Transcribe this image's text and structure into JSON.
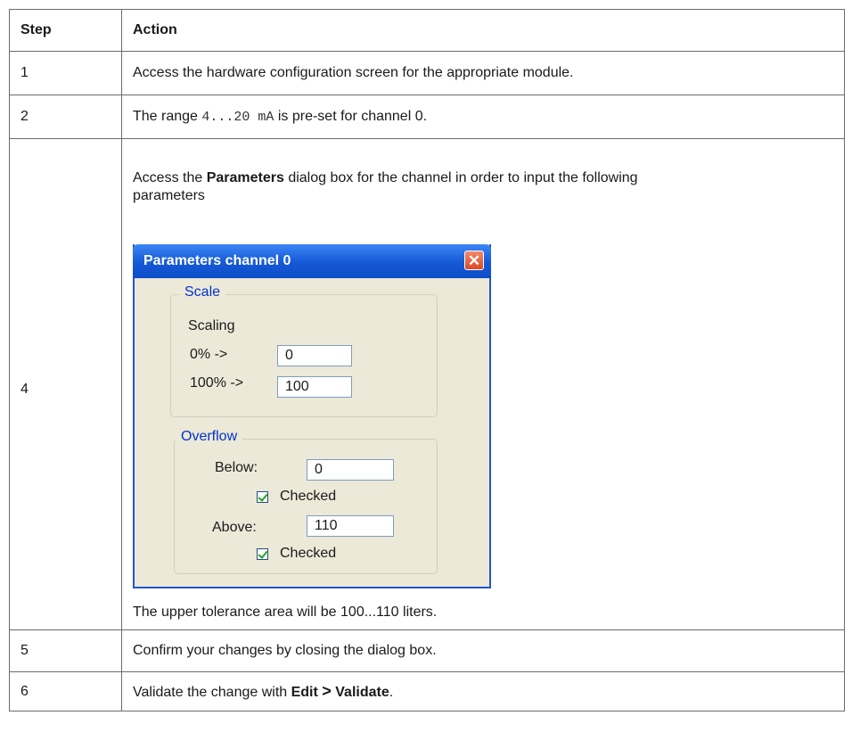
{
  "table": {
    "headers": {
      "step": "Step",
      "action": "Action"
    },
    "rows": [
      {
        "step": "1",
        "action": "Access the hardware configuration screen for the appropriate module."
      },
      {
        "step": "2",
        "pre": "The range ",
        "code": "4...20 mA",
        "post": " is pre-set for channel 0."
      },
      {
        "step": "4",
        "intro_pre": "Access the ",
        "intro_bold": "Parameters",
        "intro_post": " dialog box for the channel in order to input the following parameters",
        "after": "The upper tolerance area will be 100...110 liters."
      },
      {
        "step": "5",
        "action": "Confirm your changes by closing the dialog box."
      },
      {
        "step": "6",
        "pre": "Validate the change with ",
        "bold1": "Edit",
        "arrow": ">",
        "bold2": "Validate",
        "post": "."
      }
    ]
  },
  "dialog": {
    "title": "Parameters channel 0",
    "close_glyph": "✕",
    "scale": {
      "legend": "Scale",
      "sublabel": "Scaling",
      "zero_label": "0% ->",
      "zero_value": "0",
      "hundred_label": "100% ->",
      "hundred_value": "100"
    },
    "overflow": {
      "legend": "Overflow",
      "below_label": "Below:",
      "below_value": "0",
      "below_check": "Checked",
      "above_label": "Above:",
      "above_value": "110",
      "above_check": "Checked"
    },
    "colors": {
      "title_bar": "#1558d6",
      "body": "#ece9d8",
      "legend": "#0033cc",
      "close": "#d94a24"
    }
  }
}
